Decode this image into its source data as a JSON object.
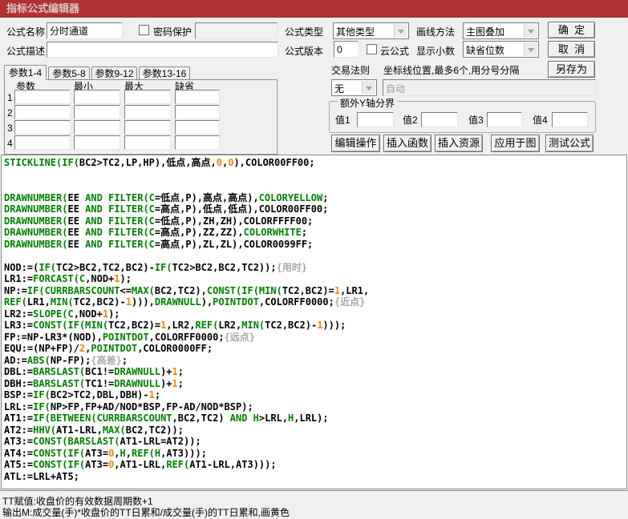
{
  "colors": {
    "title_red": "#b13030",
    "kw_green": "#008000",
    "num_orange": "#ff8000",
    "comment_gray": "#a8a8a8"
  },
  "window": {
    "title": "指标公式编辑器"
  },
  "header": {
    "name_label": "公式名称",
    "name_value": "分时通道",
    "password_label": "密码保护",
    "password_value": "",
    "desc_label": "公式描述",
    "desc_value": "",
    "type_label": "公式类型",
    "type_value": "其他类型",
    "draw_label": "画线方法",
    "draw_value": "主图叠加",
    "version_label": "公式版本",
    "version_value": "0",
    "cloud_label": "云公式",
    "decimal_label": "显示小数",
    "decimal_value": "缺省位数"
  },
  "rules": {
    "trade_rule_label": "交易法则",
    "coord_hint": "坐标线位置,最多6个,用分号分隔",
    "coord_mode_value": "无",
    "coord_line_value": "自动"
  },
  "buttons": {
    "ok": "确  定",
    "cancel": "取  消",
    "save_as": "另存为",
    "edit_op": "编辑操作",
    "insert_func": "插入函数",
    "insert_res": "插入资源",
    "apply_to_chart": "应用于图",
    "test_formula": "测试公式"
  },
  "tabs": [
    {
      "label": "参数1-4",
      "active": true
    },
    {
      "label": "参数5-8",
      "active": false
    },
    {
      "label": "参数9-12",
      "active": false
    },
    {
      "label": "参数13-16",
      "active": false
    }
  ],
  "param_panel": {
    "headers": [
      "参数",
      "最小",
      "最大",
      "缺省"
    ],
    "row_labels": [
      "1",
      "2",
      "3",
      "4"
    ],
    "values": [
      [
        "",
        "",
        "",
        ""
      ],
      [
        "",
        "",
        "",
        ""
      ],
      [
        "",
        "",
        "",
        ""
      ],
      [
        "",
        "",
        "",
        ""
      ]
    ]
  },
  "y_axis": {
    "title": "额外Y轴分界",
    "fields": [
      {
        "label": "值1",
        "value": ""
      },
      {
        "label": "值2",
        "value": ""
      },
      {
        "label": "值3",
        "value": ""
      },
      {
        "label": "值4",
        "value": ""
      }
    ]
  },
  "code": {
    "lines": [
      [
        [
          "k",
          "STICKLINE(IF("
        ],
        [
          "t",
          "BC2>TC2,LP,HP),低点,高点,"
        ],
        [
          "n",
          "0"
        ],
        [
          "t",
          ","
        ],
        [
          "n",
          "0"
        ],
        [
          "t",
          "),COLOR00FF00;"
        ]
      ],
      [],
      [],
      [
        [
          "k",
          "DRAWNUMBER("
        ],
        [
          "t",
          "EE "
        ],
        [
          "k",
          "AND"
        ],
        [
          "t",
          " "
        ],
        [
          "k",
          "FILTER(C"
        ],
        [
          "t",
          "=低点,P),高点,高点),"
        ],
        [
          "k",
          "COLORYELLOW"
        ],
        [
          "t",
          ";"
        ]
      ],
      [
        [
          "k",
          "DRAWNUMBER("
        ],
        [
          "t",
          "EE "
        ],
        [
          "k",
          "AND"
        ],
        [
          "t",
          " "
        ],
        [
          "k",
          "FILTER(C"
        ],
        [
          "t",
          "=高点,P),低点,低点),COLOR00FF00;"
        ]
      ],
      [
        [
          "k",
          "DRAWNUMBER("
        ],
        [
          "t",
          "EE "
        ],
        [
          "k",
          "AND"
        ],
        [
          "t",
          " "
        ],
        [
          "k",
          "FILTER(C"
        ],
        [
          "t",
          "=低点,P),ZH,ZH),COLORFFFF00;"
        ]
      ],
      [
        [
          "k",
          "DRAWNUMBER("
        ],
        [
          "t",
          "EE "
        ],
        [
          "k",
          "AND"
        ],
        [
          "t",
          " "
        ],
        [
          "k",
          "FILTER(C"
        ],
        [
          "t",
          "=高点,P),ZZ,ZZ),"
        ],
        [
          "k",
          "COLORWHITE"
        ],
        [
          "t",
          ";"
        ]
      ],
      [
        [
          "k",
          "DRAWNUMBER("
        ],
        [
          "t",
          "EE "
        ],
        [
          "k",
          "AND"
        ],
        [
          "t",
          " "
        ],
        [
          "k",
          "FILTER(C"
        ],
        [
          "t",
          "=高点,P),ZL,ZL),COLOR0099FF;"
        ]
      ],
      [],
      [
        [
          "t",
          "NOD:=("
        ],
        [
          "k",
          "IF("
        ],
        [
          "t",
          "TC2>BC2,TC2,BC2)-"
        ],
        [
          "k",
          "IF("
        ],
        [
          "t",
          "TC2>BC2,BC2,TC2));"
        ],
        [
          "c",
          "{用时}"
        ]
      ],
      [
        [
          "t",
          "LR1:="
        ],
        [
          "k",
          "FORCAST(C"
        ],
        [
          "t",
          ",NOD+"
        ],
        [
          "n",
          "1"
        ],
        [
          "t",
          ");"
        ]
      ],
      [
        [
          "t",
          "NP:="
        ],
        [
          "k",
          "IF(CURRBARSCOUNT"
        ],
        [
          "t",
          "<="
        ],
        [
          "k",
          "MAX("
        ],
        [
          "t",
          "BC2,TC2),"
        ],
        [
          "k",
          "CONST(IF(MIN("
        ],
        [
          "t",
          "TC2,BC2)="
        ],
        [
          "n",
          "1"
        ],
        [
          "t",
          ",LR1,"
        ]
      ],
      [
        [
          "k",
          "REF("
        ],
        [
          "t",
          "LR1,"
        ],
        [
          "k",
          "MIN("
        ],
        [
          "t",
          "TC2,BC2)-"
        ],
        [
          "n",
          "1"
        ],
        [
          "t",
          "))),"
        ],
        [
          "k",
          "DRAWNULL"
        ],
        [
          "t",
          "),"
        ],
        [
          "k",
          "POINTDOT"
        ],
        [
          "t",
          ",COLORFF0000;"
        ],
        [
          "c",
          "{近点}"
        ]
      ],
      [
        [
          "t",
          "LR2:="
        ],
        [
          "k",
          "SLOPE(C"
        ],
        [
          "t",
          ",NOD+"
        ],
        [
          "n",
          "1"
        ],
        [
          "t",
          ");"
        ]
      ],
      [
        [
          "t",
          "LR3:="
        ],
        [
          "k",
          "CONST(IF(MIN("
        ],
        [
          "t",
          "TC2,BC2)="
        ],
        [
          "n",
          "1"
        ],
        [
          "t",
          ",LR2,"
        ],
        [
          "k",
          "REF("
        ],
        [
          "t",
          "LR2,"
        ],
        [
          "k",
          "MIN("
        ],
        [
          "t",
          "TC2,BC2)-"
        ],
        [
          "n",
          "1"
        ],
        [
          "t",
          ")));"
        ]
      ],
      [
        [
          "t",
          "FP:=NP-LR3*(NOD),"
        ],
        [
          "k",
          "POINTDOT"
        ],
        [
          "t",
          ",COLORFF0000;"
        ],
        [
          "c",
          "{远点}"
        ]
      ],
      [
        [
          "t",
          "EQU:=(NP+FP)/"
        ],
        [
          "n",
          "2"
        ],
        [
          "t",
          ","
        ],
        [
          "k",
          "POINTDOT"
        ],
        [
          "t",
          ",COLOR0000FF;"
        ]
      ],
      [
        [
          "t",
          "AD:="
        ],
        [
          "k",
          "ABS("
        ],
        [
          "t",
          "NP-FP);"
        ],
        [
          "c",
          "{高差}"
        ],
        [
          "t",
          ";"
        ]
      ],
      [
        [
          "t",
          "DBL:="
        ],
        [
          "k",
          "BARSLAST("
        ],
        [
          "t",
          "BC1!="
        ],
        [
          "k",
          "DRAWNULL"
        ],
        [
          "t",
          ")+"
        ],
        [
          "n",
          "1"
        ],
        [
          "t",
          ";"
        ]
      ],
      [
        [
          "t",
          "DBH:="
        ],
        [
          "k",
          "BARSLAST("
        ],
        [
          "t",
          "TC1!="
        ],
        [
          "k",
          "DRAWNULL"
        ],
        [
          "t",
          ")+"
        ],
        [
          "n",
          "1"
        ],
        [
          "t",
          ";"
        ]
      ],
      [
        [
          "t",
          "BSP:="
        ],
        [
          "k",
          "IF("
        ],
        [
          "t",
          "BC2>TC2,DBL,DBH)-"
        ],
        [
          "n",
          "1"
        ],
        [
          "t",
          ";"
        ]
      ],
      [
        [
          "t",
          "LRL:="
        ],
        [
          "k",
          "IF("
        ],
        [
          "t",
          "NP>FP,FP+AD/NOD*BSP,FP-AD/NOD*BSP);"
        ]
      ],
      [
        [
          "t",
          "AT1:="
        ],
        [
          "k",
          "IF(BETWEEN(CURRBARSCOUNT"
        ],
        [
          "t",
          ",BC2,TC2) "
        ],
        [
          "k",
          "AND H"
        ],
        [
          "t",
          ">LRL,"
        ],
        [
          "k",
          "H"
        ],
        [
          "t",
          ",LRL);"
        ]
      ],
      [
        [
          "t",
          "AT2:="
        ],
        [
          "k",
          "HHV("
        ],
        [
          "t",
          "AT1-LRL,"
        ],
        [
          "k",
          "MAX("
        ],
        [
          "t",
          "BC2,TC2));"
        ]
      ],
      [
        [
          "t",
          "AT3:="
        ],
        [
          "k",
          "CONST(BARSLAST("
        ],
        [
          "t",
          "AT1-LRL=AT2));"
        ]
      ],
      [
        [
          "t",
          "AT4:="
        ],
        [
          "k",
          "CONST(IF("
        ],
        [
          "t",
          "AT3="
        ],
        [
          "n",
          "0"
        ],
        [
          "t",
          ","
        ],
        [
          "k",
          "H"
        ],
        [
          "t",
          ","
        ],
        [
          "k",
          "REF(H"
        ],
        [
          "t",
          ",AT3)));"
        ]
      ],
      [
        [
          "t",
          "AT5:="
        ],
        [
          "k",
          "CONST(IF("
        ],
        [
          "t",
          "AT3="
        ],
        [
          "n",
          "0"
        ],
        [
          "t",
          ",AT1-LRL,"
        ],
        [
          "k",
          "REF("
        ],
        [
          "t",
          "AT1-LRL,AT3)));"
        ]
      ],
      [
        [
          "t",
          "ATL:=LRL+AT5;"
        ]
      ]
    ]
  },
  "status": {
    "lines": [
      "TT赋值:收盘价的有效数据周期数+1",
      "输出M:成交量(手)*收盘价的TT日累和/成交量(手)的TT日累和,画黄色"
    ]
  }
}
